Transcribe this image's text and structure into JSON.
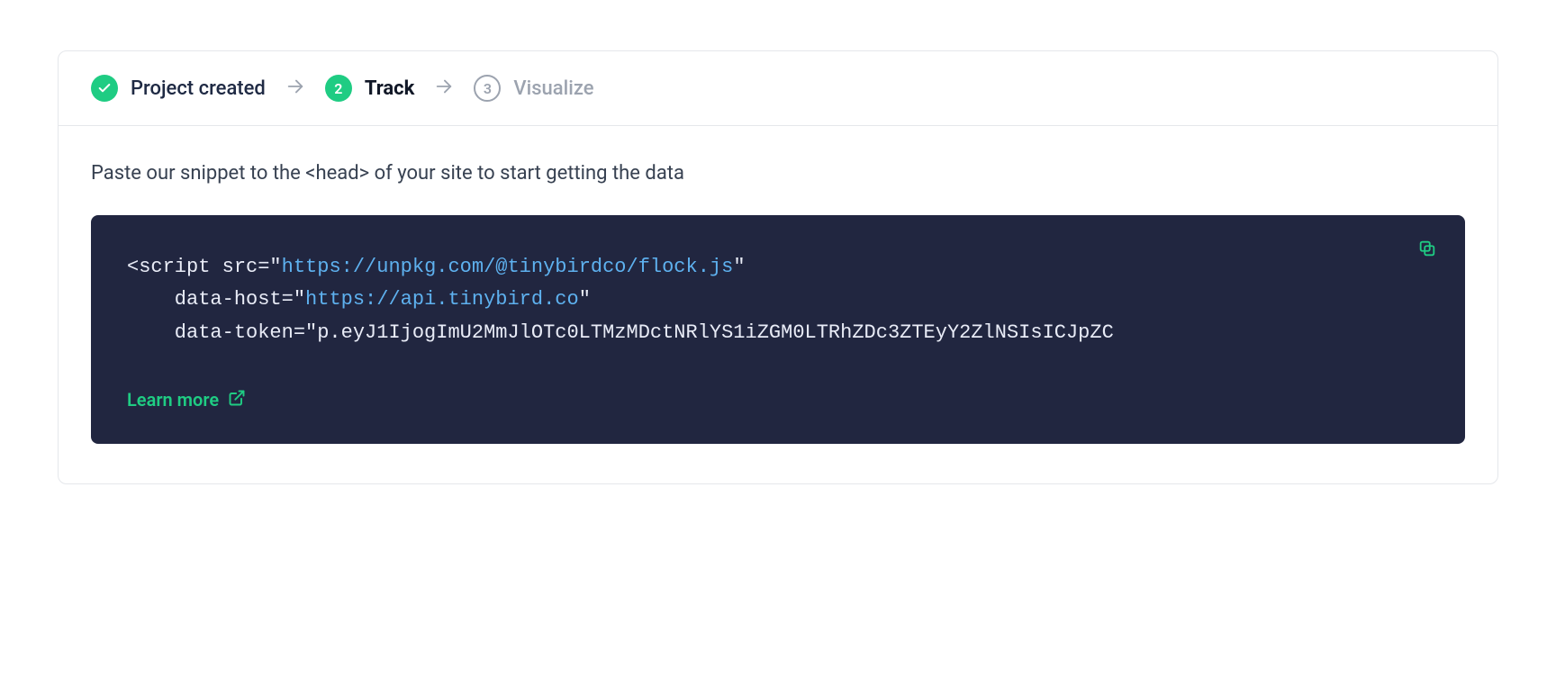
{
  "stepper": {
    "step1": {
      "label": "Project created"
    },
    "step2": {
      "num": "2",
      "label": "Track"
    },
    "step3": {
      "num": "3",
      "label": "Visualize"
    }
  },
  "instruction": "Paste our snippet to the <head> of your site to start getting the data",
  "snippet": {
    "tag_open": "<script src=\"",
    "src_url": "https://unpkg.com/@tinybirdco/flock.js",
    "src_close": "\"",
    "host_pre": "    data-host=\"",
    "host_url": "https://api.tinybird.co",
    "host_close": "\"",
    "token_line": "    data-token=\"p.eyJ1IjogImU2MmJlOTc0LTMzMDctNRlYS1iZGM0LTRhZDc3ZTEyY2ZlNSIsICJpZC"
  },
  "learn_more": "Learn more"
}
